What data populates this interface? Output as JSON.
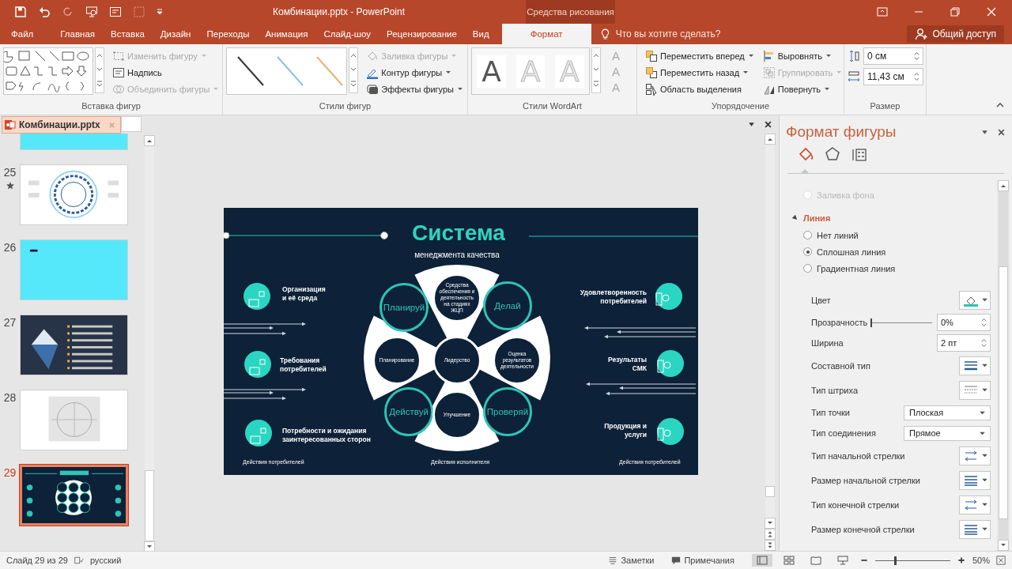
{
  "window": {
    "title": "Комбинации.pptx - PowerPoint",
    "context_tab": "Средства рисования"
  },
  "menu_tabs": [
    {
      "label": "Файл",
      "selected": false
    },
    {
      "label": "Главная",
      "selected": false
    },
    {
      "label": "Вставка",
      "selected": false
    },
    {
      "label": "Дизайн",
      "selected": false
    },
    {
      "label": "Переходы",
      "selected": false
    },
    {
      "label": "Анимация",
      "selected": false
    },
    {
      "label": "Слайд-шоу",
      "selected": false
    },
    {
      "label": "Рецензирование",
      "selected": false
    },
    {
      "label": "Вид",
      "selected": false
    },
    {
      "label": "Формат",
      "selected": true
    }
  ],
  "tell_me": {
    "placeholder": "Что вы хотите сделать?"
  },
  "share_button": "Общий доступ",
  "ribbon": [
    {
      "kind": "shapes",
      "title": "Вставка фигур",
      "buttons": [
        {
          "label": "Изменить фигуру",
          "disabled": true
        },
        {
          "label": "Надпись",
          "disabled": false
        },
        {
          "label": "Объединить фигуры",
          "disabled": true
        }
      ]
    },
    {
      "kind": "styles",
      "title": "Стили фигур",
      "buttons": [
        {
          "label": "Заливка фигуры",
          "disabled": true
        },
        {
          "label": "Контур фигуры",
          "disabled": false
        },
        {
          "label": "Эффекты фигуры",
          "disabled": false
        }
      ]
    },
    {
      "kind": "wordart",
      "title": "Стили WordArt",
      "styles": [
        {
          "label": "A",
          "disabled": false
        },
        {
          "label": "A",
          "disabled": true
        },
        {
          "label": "A",
          "disabled": true
        }
      ],
      "buttons": [
        {
          "label": "A",
          "disabled": true
        },
        {
          "label": "A",
          "disabled": true
        },
        {
          "label": "A",
          "disabled": true
        }
      ]
    },
    {
      "kind": "arrange",
      "title": "Упорядочение",
      "buttons": [
        {
          "label": "Переместить вперед",
          "disabled": false
        },
        {
          "label": "Выровнять",
          "disabled": false
        },
        {
          "label": "Переместить назад",
          "disabled": false
        },
        {
          "label": "Группировать",
          "disabled": true
        },
        {
          "label": "Область выделения",
          "disabled": false
        },
        {
          "label": "Повернуть",
          "disabled": false
        }
      ]
    },
    {
      "kind": "size",
      "title": "Размер",
      "fields": [
        {
          "value": "0 см"
        },
        {
          "value": "11,43 см"
        }
      ]
    }
  ],
  "document_tab": "Комбинации.pptx",
  "thumbnails": [
    {
      "kind": "cyan",
      "selected": false
    },
    {
      "number": "25",
      "kind": "rings",
      "selected": false,
      "transition": true
    },
    {
      "number": "26",
      "kind": "cyan",
      "selected": false
    },
    {
      "number": "27",
      "kind": "iceberg",
      "selected": false
    },
    {
      "number": "28",
      "kind": "diagram",
      "selected": false
    },
    {
      "number": "29",
      "kind": "system",
      "selected": true
    }
  ],
  "slide": {
    "title": "Система",
    "subtitle": "менеджмента качества",
    "left_items": [
      "Организация и её среда",
      "Требования потребителей",
      "Потребности и ожидания заинтересованных сторон"
    ],
    "right_items": [
      "Удовлетворенность потребителей",
      "Результаты СМК",
      "Продукция и услуги"
    ],
    "cycle": [
      {
        "label": "Планируй",
        "kind": "stage"
      },
      {
        "label": "Средства обеспечения и деятельность на стадиях ЖЦП",
        "kind": "process"
      },
      {
        "label": "Делай",
        "kind": "stage"
      },
      {
        "label": "Планирование",
        "kind": "process"
      },
      {
        "label": "Лидерство",
        "kind": "process"
      },
      {
        "label": "Оценка результатов деятельности",
        "kind": "process"
      },
      {
        "label": "Действуй",
        "kind": "stage"
      },
      {
        "label": "Улучшение",
        "kind": "process"
      },
      {
        "label": "Проверяй",
        "kind": "stage"
      }
    ],
    "footers": [
      "Действия потребителей",
      "Действия исполнителя",
      "Действия потребителей"
    ]
  },
  "format_pane": {
    "title": "Формат фигуры",
    "tabs": [
      {
        "selected": true
      },
      {
        "selected": false
      },
      {
        "selected": false
      }
    ],
    "fill_option": {
      "label": "Заливка фона",
      "disabled": true
    },
    "section": {
      "label": "Линия",
      "expanded": true
    },
    "line_options": [
      {
        "label": "Нет линий",
        "selected": false
      },
      {
        "label": "Сплошная линия",
        "selected": true
      },
      {
        "label": "Градиентная линия",
        "selected": false
      }
    ],
    "properties": [
      {
        "kind": "color",
        "label": "Цвет"
      },
      {
        "kind": "slider",
        "label": "Прозрачность",
        "level": 0,
        "value": "0%"
      },
      {
        "kind": "spin",
        "label": "Ширина",
        "value": "2 пт"
      },
      {
        "kind": "compound",
        "label": "Составной тип"
      },
      {
        "kind": "dash",
        "label": "Тип штриха"
      },
      {
        "kind": "select",
        "label": "Тип точки",
        "value": "Плоская"
      },
      {
        "kind": "select",
        "label": "Тип соединения",
        "value": "Прямое"
      },
      {
        "kind": "arrow",
        "label": "Тип начальной стрелки"
      },
      {
        "kind": "size",
        "label": "Размер начальной стрелки"
      },
      {
        "kind": "arrow",
        "label": "Тип конечной стрелки"
      },
      {
        "kind": "size",
        "label": "Размер конечной стрелки"
      }
    ]
  },
  "status_bar": {
    "slide": "Слайд 29 из 29",
    "language": "русский",
    "notes": "Заметки",
    "comments": "Примечания",
    "views": [
      {
        "selected": true
      },
      {
        "selected": false
      },
      {
        "selected": false
      },
      {
        "selected": false
      }
    ],
    "zoom": {
      "level": 0.25,
      "value": "50%"
    }
  }
}
